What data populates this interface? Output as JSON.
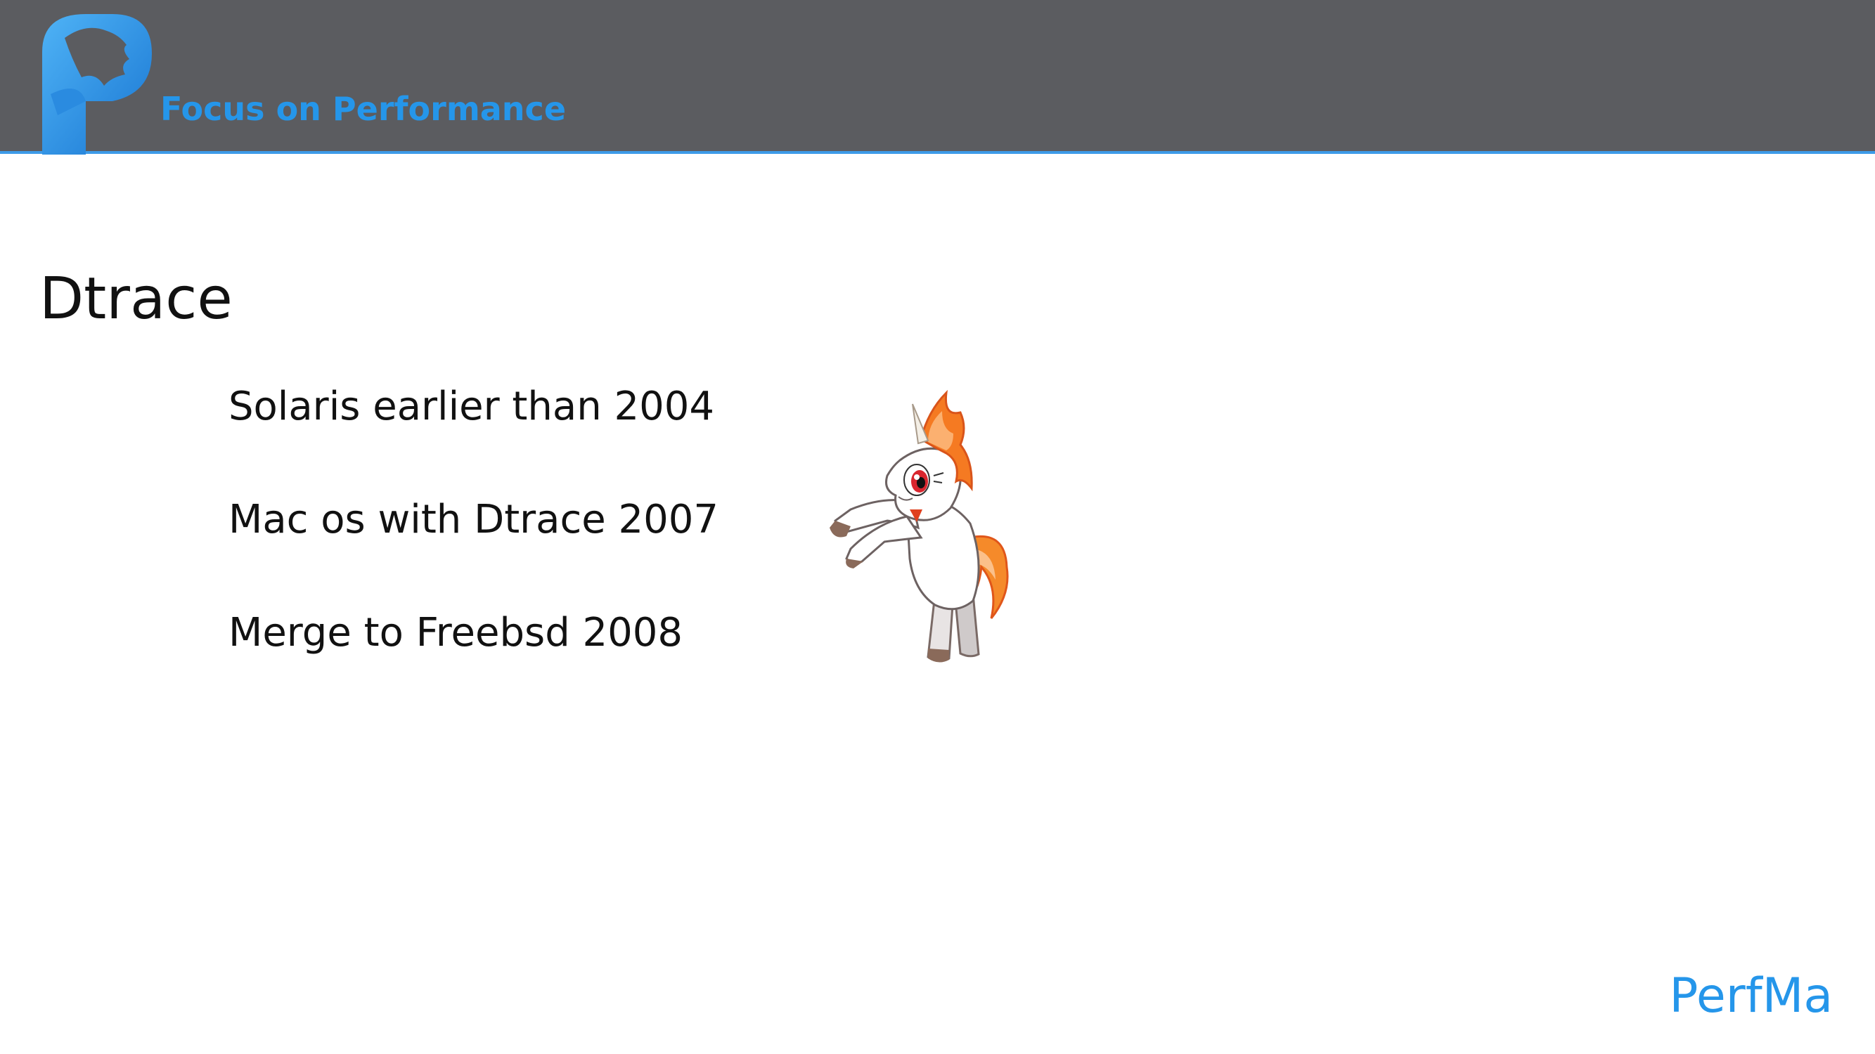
{
  "header": {
    "tagline": "Focus on Performance",
    "background_color": "#5b5c60",
    "accent_color": "#2596ea",
    "logo_icon": "perfma-logo-icon"
  },
  "slide": {
    "title": "Dtrace",
    "bullets": [
      "Solaris  earlier than 2004",
      "Mac os with Dtrace 2007",
      "Merge to Freebsd 2008"
    ],
    "illustration_icon": "unicorn-pony-icon"
  },
  "footer": {
    "brand": "PerfMa"
  }
}
